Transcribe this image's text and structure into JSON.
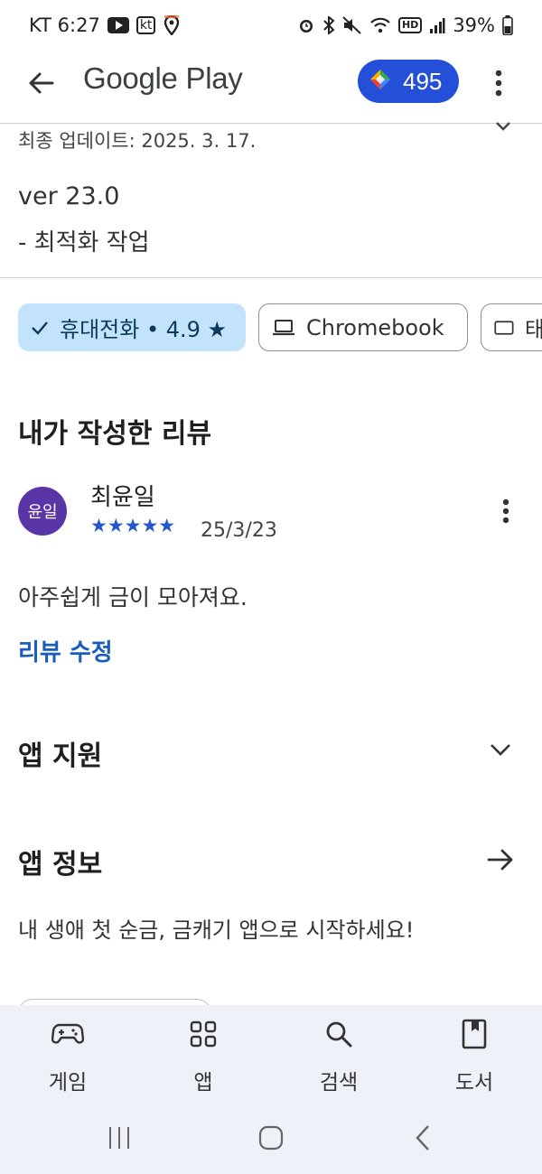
{
  "status_bar": {
    "carrier_time": "KT 6:27",
    "carrier_badge": "kt",
    "battery": "39%",
    "hd_badge": "HD",
    "icons_left": [
      "youtube-icon",
      "kt-icon",
      "location-icon"
    ],
    "icons_right": [
      "alarm-icon",
      "bluetooth-icon",
      "mute-icon",
      "wifi-icon",
      "hd-icon",
      "signal-icon",
      "battery-icon"
    ]
  },
  "app_bar": {
    "title": "Google Play",
    "points": "495"
  },
  "update": {
    "last_updated": "최종 업데이트: 2025. 3. 17.",
    "version": "ver 23.0",
    "note": "- 최적화 작업"
  },
  "chips": [
    {
      "label": "휴대전화 • 4.9 ★",
      "selected": true,
      "icon": "check-icon"
    },
    {
      "label": "Chromebook",
      "selected": false,
      "icon": "laptop-icon"
    },
    {
      "label": "태",
      "selected": false,
      "icon": "tablet-icon"
    }
  ],
  "my_review": {
    "section_title": "내가 작성한 리뷰",
    "avatar_text": "윤일",
    "reviewer": "최윤일",
    "rating": 5,
    "stars": "★★★★★",
    "date": "25/3/23",
    "text": "아주쉽게 금이 모아져요.",
    "edit_label": "리뷰 수정"
  },
  "app_support": {
    "title": "앱 지원"
  },
  "app_info": {
    "title": "앱 정보",
    "description": "내 생애 첫 순금, 금캐기 앱으로 시작하세요!"
  },
  "bottom_nav": [
    {
      "label": "게임",
      "icon": "gamepad-icon"
    },
    {
      "label": "앱",
      "icon": "apps-grid-icon"
    },
    {
      "label": "검색",
      "icon": "search-icon"
    },
    {
      "label": "도서",
      "icon": "book-icon"
    }
  ],
  "colors": {
    "accent": "#1a5dbf",
    "points_pill": "#2450d9",
    "chip_selected": "#c3e3fb",
    "avatar": "#5a35a8",
    "nav_background": "#eef2f8"
  }
}
